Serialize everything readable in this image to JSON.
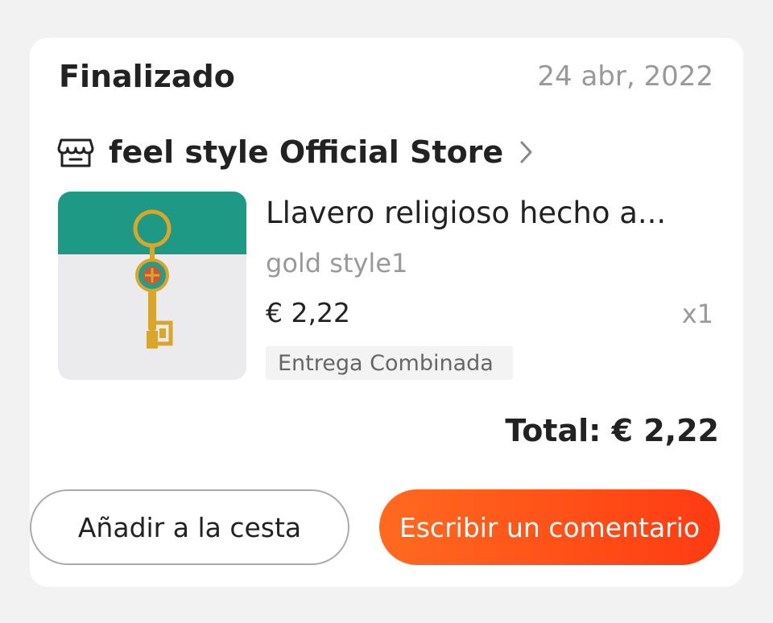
{
  "order": {
    "status": "Finalizado",
    "date": "24 abr, 2022"
  },
  "store": {
    "name": "feel style Official Store",
    "icon": "store-icon"
  },
  "item": {
    "title": "Llavero religioso hecho a...",
    "variant": "gold style1",
    "price": "€ 2,22",
    "quantity": "x1",
    "tag": "Entrega Combinada"
  },
  "total": "Total: € 2,22",
  "actions": {
    "add_to_cart": "Añadir a la cesta",
    "write_review": "Escribir un comentario"
  },
  "colors": {
    "accent_start": "#ff6a1f",
    "accent_end": "#ff3b12"
  }
}
